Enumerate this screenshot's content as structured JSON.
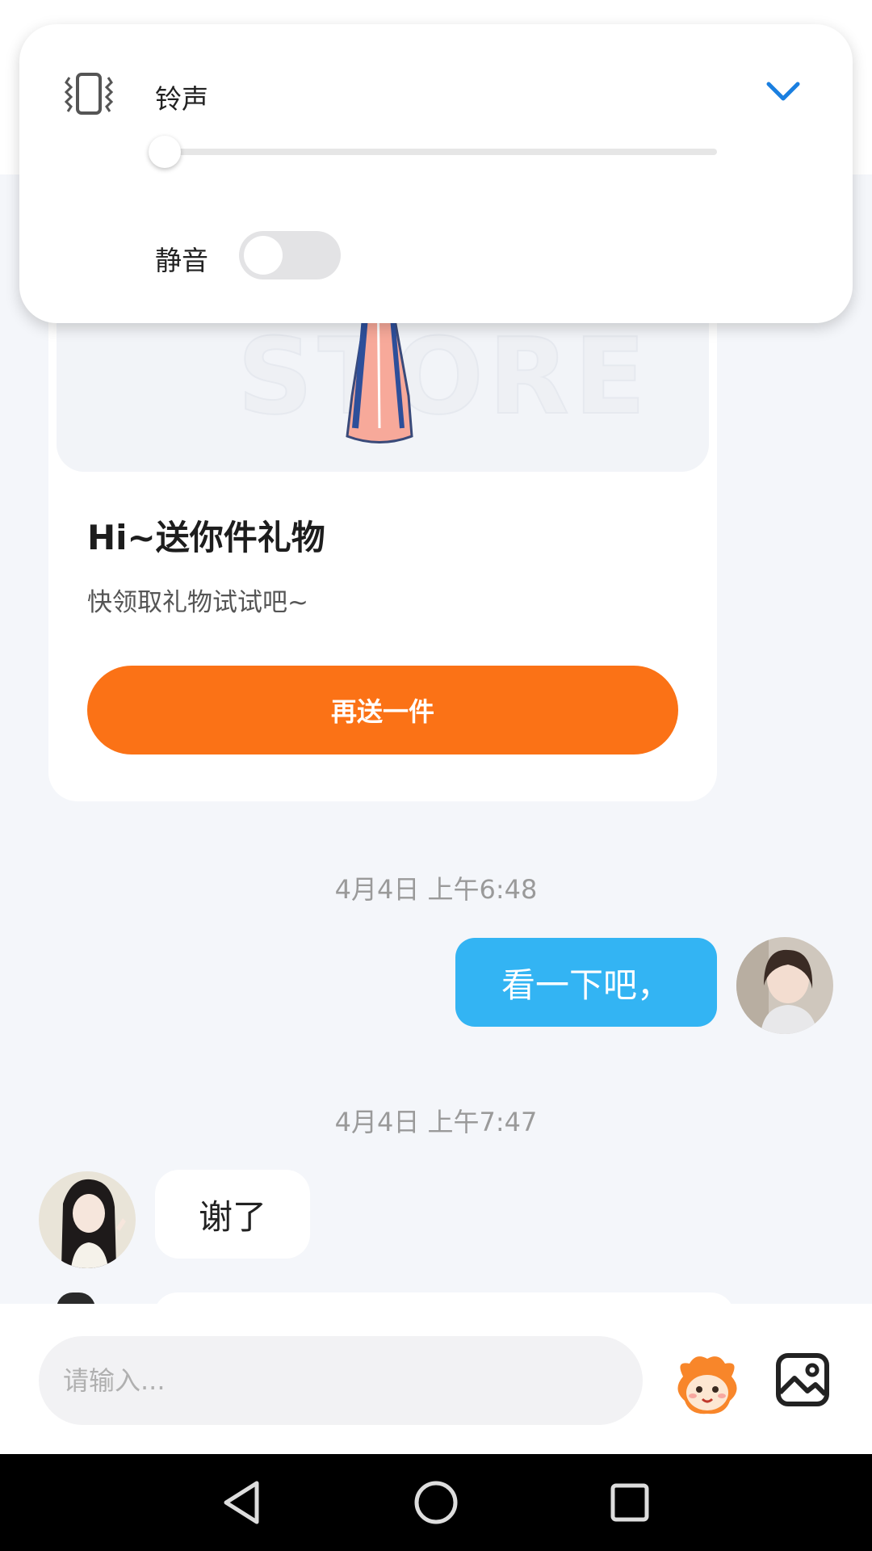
{
  "volume_panel": {
    "ringtone_label": "铃声",
    "mute_label": "静音",
    "volume_level": 0,
    "mute_on": false
  },
  "gift_card": {
    "watermark": "STORE",
    "title": "Hi~送你件礼物",
    "subtitle": "快领取礼物试试吧~",
    "button_label": "再送一件"
  },
  "messages": [
    {
      "timestamp": "4月4日 上午6:48",
      "direction": "out",
      "text": "看一下吧，"
    },
    {
      "timestamp": "4月4日 上午7:47",
      "direction": "in",
      "text": "谢了"
    }
  ],
  "input_bar": {
    "placeholder": "请输入..."
  },
  "colors": {
    "accent_orange": "#fb7216",
    "bubble_blue": "#33b4f3",
    "page_bg": "#f4f6fa",
    "chevron_blue": "#1a7fe0"
  },
  "icons": {
    "vibrate": "vibrate-icon",
    "expand": "chevron-down-icon",
    "sticker": "sticker-icon",
    "image": "image-icon",
    "back": "back-triangle-icon",
    "home": "home-circle-icon",
    "recents": "recents-square-icon"
  }
}
